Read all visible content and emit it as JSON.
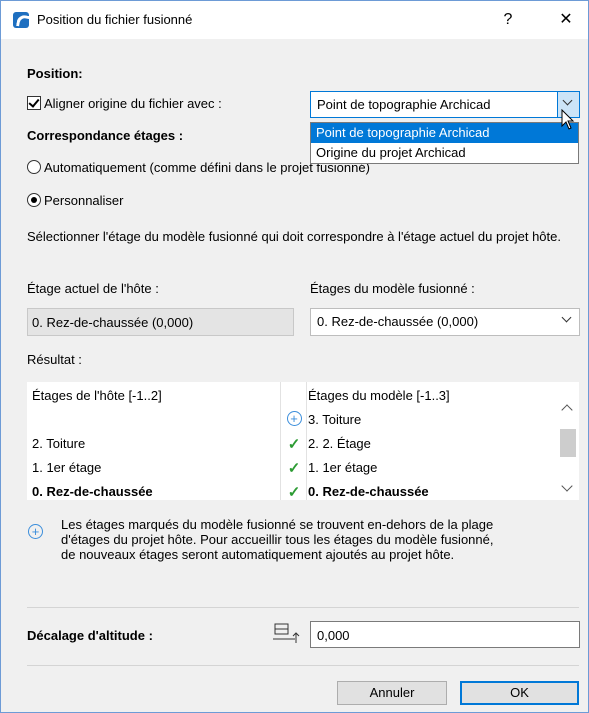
{
  "window": {
    "title": "Position du fichier fusionné",
    "help": "?",
    "close": "✕"
  },
  "position": {
    "section_label": "Position:",
    "align_label": "Aligner origine du fichier avec :",
    "align_checked": true,
    "align_value": "Point de topographie Archicad",
    "align_options": [
      "Point de topographie Archicad",
      "Origine du projet Archicad"
    ]
  },
  "stories": {
    "section_label": "Correspondance étages :",
    "auto_label": "Automatiquement (comme défini dans le projet fusionné)",
    "custom_label": "Personnaliser",
    "selected_mode": "custom",
    "description": "Sélectionner l'étage du modèle fusionné qui doit correspondre à l'étage actuel du projet hôte.",
    "host_label": "Étage actuel de l'hôte :",
    "host_value": "0. Rez-de-chaussée (0,000)",
    "merged_label": "Étages du modèle fusionné :",
    "merged_value": "0. Rez-de-chaussée (0,000)"
  },
  "result": {
    "label": "Résultat :",
    "host_header": "Étages de l'hôte [-1..2]",
    "model_header": "Étages du modèle [-1..3]",
    "rows": [
      {
        "host": "",
        "mark": "plus",
        "model": "3. Toiture",
        "bold": false
      },
      {
        "host": "2. Toiture",
        "mark": "check",
        "model": "2. 2. Étage",
        "bold": false
      },
      {
        "host": "1. 1er étage",
        "mark": "check",
        "model": "1. 1er étage",
        "bold": false
      },
      {
        "host": "0. Rez-de-chaussée",
        "mark": "check",
        "model": "0. Rez-de-chaussée",
        "bold": true
      }
    ]
  },
  "info": {
    "text_line1": "Les étages marqués du modèle fusionné se trouvent en-dehors de la plage",
    "text_line2": "d'étages du projet hôte. Pour accueillir tous les étages du modèle fusionné,",
    "text_line3": "de nouveaux étages seront automatiquement ajoutés au projet hôte."
  },
  "elevation": {
    "label": "Décalage d'altitude :",
    "value": "0,000"
  },
  "buttons": {
    "cancel": "Annuler",
    "ok": "OK"
  },
  "colors": {
    "accent": "#0078d7",
    "check": "#2c9b33",
    "plus": "#3b8edb"
  }
}
